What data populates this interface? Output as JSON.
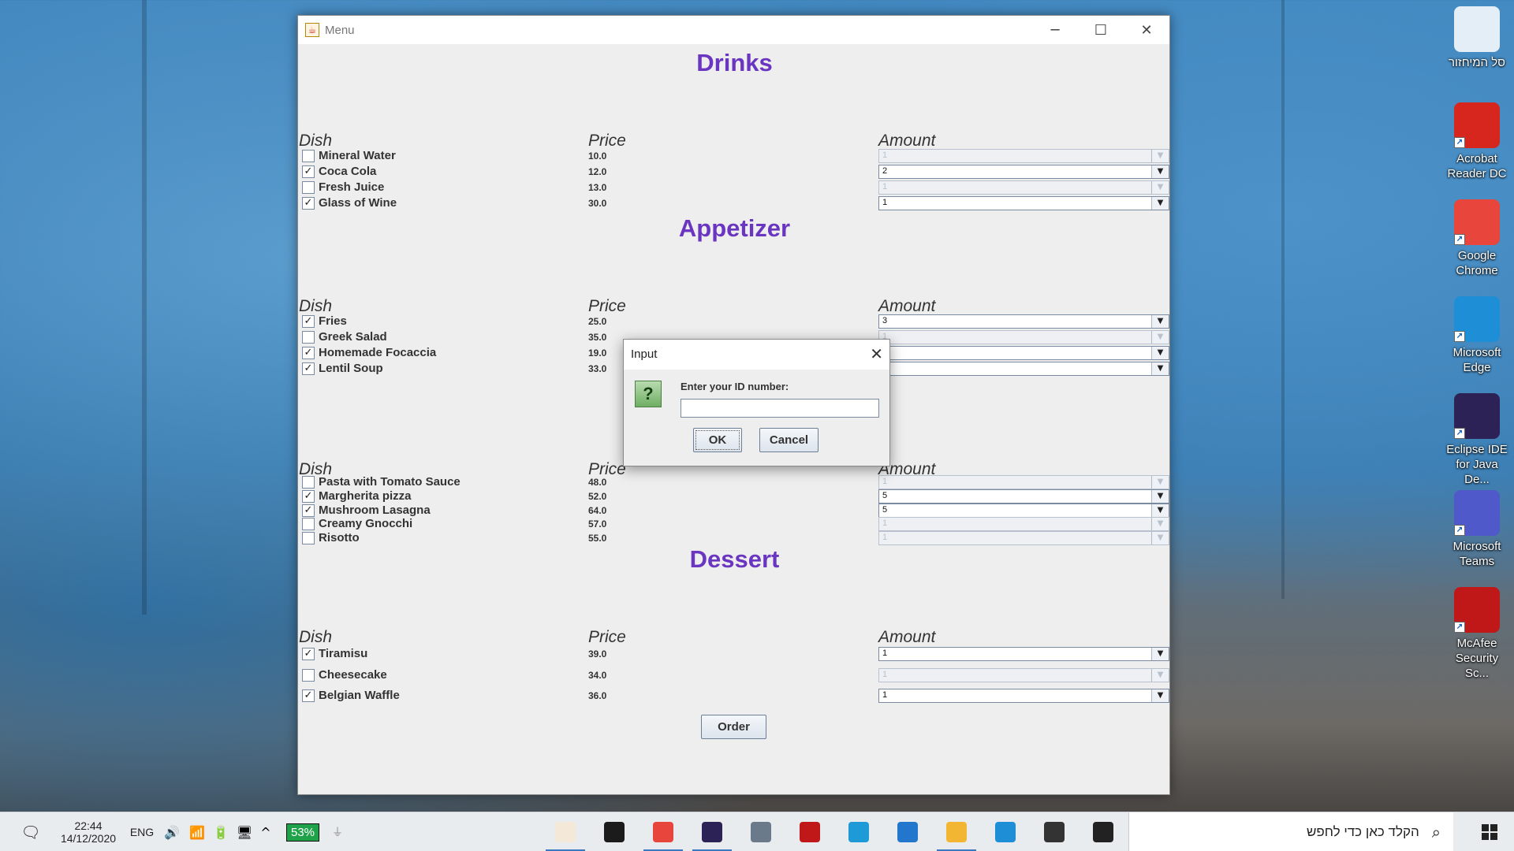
{
  "window": {
    "title": "Menu",
    "minimize_glyph": "─",
    "maximize_glyph": "☐",
    "close_glyph": "✕"
  },
  "column_headers": {
    "dish": "Dish",
    "price": "Price",
    "amount": "Amount"
  },
  "sections": [
    {
      "title": "Drinks",
      "items": [
        {
          "dish": "Mineral Water",
          "price": "10.0",
          "checked": false,
          "amount": "1"
        },
        {
          "dish": "Coca Cola",
          "price": "12.0",
          "checked": true,
          "amount": "2"
        },
        {
          "dish": "Fresh Juice",
          "price": "13.0",
          "checked": false,
          "amount": "1"
        },
        {
          "dish": "Glass of Wine",
          "price": "30.0",
          "checked": true,
          "amount": "1"
        }
      ]
    },
    {
      "title": "Appetizer",
      "items": [
        {
          "dish": "Fries",
          "price": "25.0",
          "checked": true,
          "amount": "3"
        },
        {
          "dish": "Greek Salad",
          "price": "35.0",
          "checked": false,
          "amount": "1"
        },
        {
          "dish": "Homemade Focaccia",
          "price": "19.0",
          "checked": true,
          "amount": ""
        },
        {
          "dish": "Lentil Soup",
          "price": "33.0",
          "checked": true,
          "amount": ""
        }
      ]
    },
    {
      "title": "",
      "items": [
        {
          "dish": "Pasta with Tomato Sauce",
          "price": "48.0",
          "checked": false,
          "amount": "1"
        },
        {
          "dish": "Margherita pizza",
          "price": "52.0",
          "checked": true,
          "amount": "5"
        },
        {
          "dish": "Mushroom Lasagna",
          "price": "64.0",
          "checked": true,
          "amount": "5"
        },
        {
          "dish": "Creamy Gnocchi",
          "price": "57.0",
          "checked": false,
          "amount": "1"
        },
        {
          "dish": "Risotto",
          "price": "55.0",
          "checked": false,
          "amount": "1"
        }
      ]
    },
    {
      "title": "Dessert",
      "items": [
        {
          "dish": "Tiramisu",
          "price": "39.0",
          "checked": true,
          "amount": "1"
        },
        {
          "dish": "Cheesecake",
          "price": "34.0",
          "checked": false,
          "amount": "1"
        },
        {
          "dish": "Belgian Waffle",
          "price": "36.0",
          "checked": true,
          "amount": "1"
        }
      ]
    }
  ],
  "order_label": "Order",
  "dialog": {
    "title": "Input",
    "icon": "question-icon",
    "icon_glyph": "?",
    "prompt": "Enter your ID number:",
    "input_value": "",
    "ok_label": "OK",
    "cancel_label": "Cancel"
  },
  "desktop_icons": [
    {
      "label": "סל המיחזור",
      "icon": "recycle-bin-icon"
    },
    {
      "label": "Acrobat Reader DC",
      "icon": "acrobat-icon",
      "color": "#d7261e"
    },
    {
      "label": "Google Chrome",
      "icon": "chrome-icon",
      "color": "#e8453c"
    },
    {
      "label": "Microsoft Edge",
      "icon": "edge-icon",
      "color": "#1e8fd6"
    },
    {
      "label": "Eclipse IDE for Java De...",
      "icon": "eclipse-icon",
      "color": "#2c2255"
    },
    {
      "label": "Microsoft Teams",
      "icon": "teams-icon",
      "color": "#5059c9"
    },
    {
      "label": "McAfee Security Sc...",
      "icon": "mcafee-icon",
      "color": "#c01818"
    }
  ],
  "taskbar": {
    "time": "22:44",
    "date": "14/12/2020",
    "language": "ENG",
    "battery": "53%",
    "search_placeholder": "הקלד כאן כדי לחפש",
    "apps": [
      {
        "icon": "java-icon",
        "color": "#f4e9d8",
        "active": true
      },
      {
        "icon": "terminal-icon",
        "color": "#1b1b1b",
        "active": false
      },
      {
        "icon": "chrome-icon",
        "color": "#e8453c",
        "active": true
      },
      {
        "icon": "eclipse-icon",
        "color": "#2c2255",
        "active": true
      },
      {
        "icon": "calculator-icon",
        "color": "#6b7a8a",
        "active": false
      },
      {
        "icon": "mcafee-icon",
        "color": "#c01818",
        "active": false
      },
      {
        "icon": "l-app-icon",
        "color": "#1e9ad6",
        "active": false
      },
      {
        "icon": "mail-icon",
        "color": "#2277cc",
        "active": false
      },
      {
        "icon": "file-explorer-icon",
        "color": "#f2b632",
        "active": true
      },
      {
        "icon": "edge-icon",
        "color": "#1e8fd6",
        "active": false
      },
      {
        "icon": "task-view-icon",
        "color": "#333333",
        "active": false
      },
      {
        "icon": "cortana-icon",
        "color": "#222222",
        "active": false
      }
    ]
  }
}
